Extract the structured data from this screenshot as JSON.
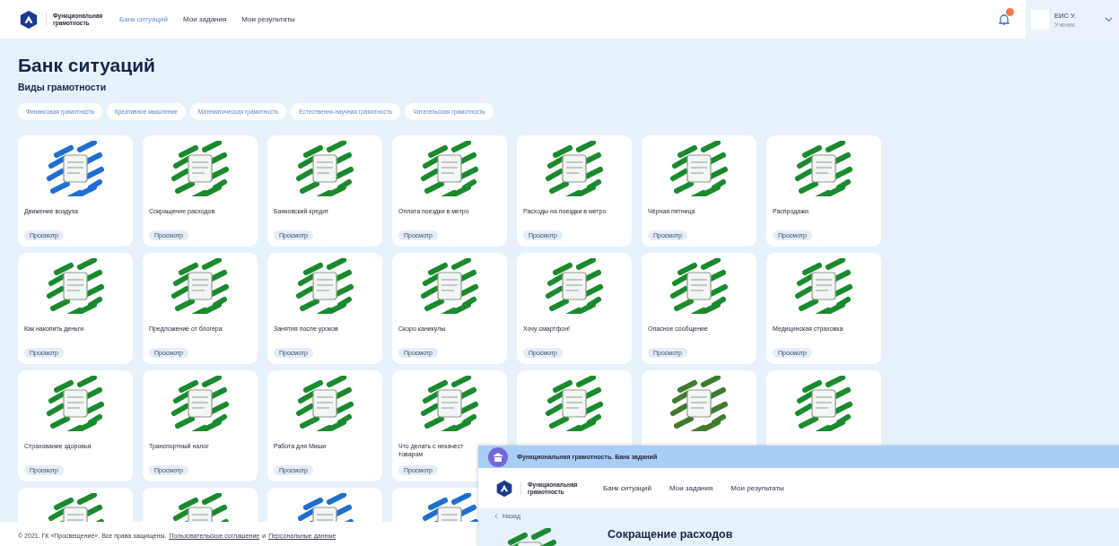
{
  "header": {
    "logo_text": "Функциональная грамотность",
    "nav": [
      {
        "label": "Банк ситуаций",
        "selected": true
      },
      {
        "label": "Мои задания",
        "selected": false
      },
      {
        "label": "Мои результаты",
        "selected": false
      }
    ],
    "notifications": {
      "unread": true
    },
    "user": {
      "name": "ЕИС У.",
      "role": "Ученик"
    }
  },
  "title": "Банк ситуаций",
  "filter_title": "Виды грамотности",
  "chips": [
    "Финансовая грамотность",
    "Креативное мышление",
    "Математическая грамотность",
    "Естественно-научная грамотность",
    "Читательская грамотность"
  ],
  "cards": [
    {
      "title": "Движение воздуха",
      "button": "Просмотр",
      "color": "#1f6fd1"
    },
    {
      "title": "Сокращение расходов",
      "button": "Просмотр",
      "color": "#1a8a2e"
    },
    {
      "title": "Банковский кредит",
      "button": "Просмотр",
      "color": "#1a8a2e"
    },
    {
      "title": "Оплата поездки в метро",
      "button": "Просмотр",
      "color": "#1a8a2e"
    },
    {
      "title": "Расходы на поездки в метро",
      "button": "Просмотр",
      "color": "#1a8a2e"
    },
    {
      "title": "Чёрная пятница",
      "button": "Просмотр",
      "color": "#1a8a2e"
    },
    {
      "title": "Распродажи",
      "button": "Просмотр",
      "color": "#1a8a2e"
    },
    {
      "title": "Как накопить деньги",
      "button": "Просмотр",
      "color": "#1a8a2e"
    },
    {
      "title": "Предложение от блогера",
      "button": "Просмотр",
      "color": "#1a8a2e"
    },
    {
      "title": "Занятия после уроков",
      "button": "Просмотр",
      "color": "#1a8a2e"
    },
    {
      "title": "Скоро каникулы",
      "button": "Просмотр",
      "color": "#1a8a2e"
    },
    {
      "title": "Хочу смартфон!",
      "button": "Просмотр",
      "color": "#1a8a2e"
    },
    {
      "title": "Опасное сообщение",
      "button": "Просмотр",
      "color": "#1a8a2e"
    },
    {
      "title": "Медицинская страховка",
      "button": "Просмотр",
      "color": "#1a8a2e"
    },
    {
      "title": "Страхование здоровья",
      "button": "Просмотр",
      "color": "#1a8a2e"
    },
    {
      "title": "Транспортный налог",
      "button": "Просмотр",
      "color": "#1a8a2e"
    },
    {
      "title": "Работа для Миши",
      "button": "Просмотр",
      "color": "#1a8a2e"
    },
    {
      "title": "Что делать с некачест\nтоваром",
      "button": "Просмотр",
      "color": "#1a8a2e"
    },
    {
      "color": "#1a8a2e"
    },
    {
      "color": "#3f7a2e"
    },
    {
      "color": "#1a8a2e"
    },
    {
      "color": "#1a8a2e"
    },
    {
      "color": "#1a8a2e"
    },
    {
      "color": "#1f6fd1"
    },
    {
      "color": "#1f6fd1"
    }
  ],
  "footer": {
    "text": "© 2021. ГК «Просвещение». Все права защищены.",
    "link1": "Пользовательское соглашение",
    "joiner": "и",
    "link2": "Персональные данные"
  },
  "overlay_window": {
    "title": "Функциональная грамотность. Банк заданий",
    "logo_text": "Функциональная грамотность",
    "nav": [
      {
        "label": "Банк ситуаций",
        "selected": false
      },
      {
        "label": "Мои задания",
        "selected": false
      },
      {
        "label": "Мои результаты",
        "selected": false
      }
    ],
    "back": "Назад",
    "heading": "Сокращение расходов"
  }
}
